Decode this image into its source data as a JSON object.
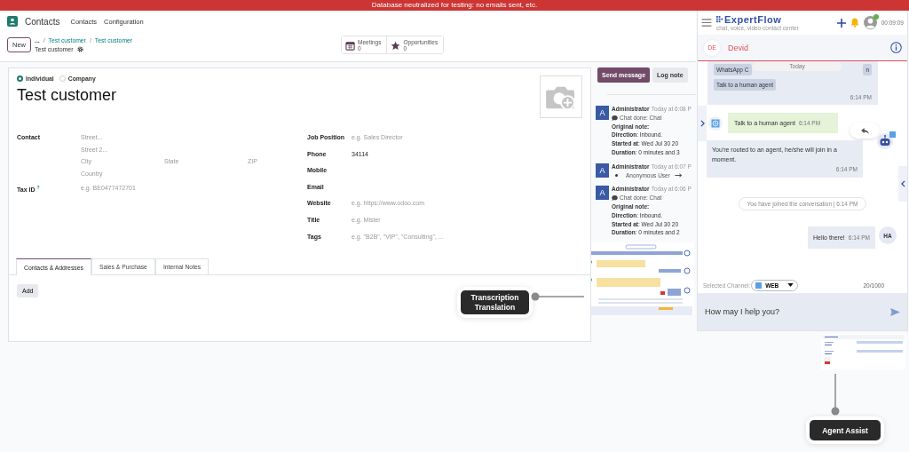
{
  "banner": "Database neutralized for testing: no emails sent, etc.",
  "app_bar": {
    "app": "Contacts",
    "menu": [
      "Contacts",
      "Configuration"
    ]
  },
  "control_panel": {
    "new_button": "New",
    "breadcrumb": [
      "...",
      "Test customer",
      "Test customer"
    ],
    "separator": "/",
    "record": "Test customer",
    "smart_buttons": [
      {
        "kind": "calendar",
        "label": "Meetings",
        "count": "0"
      },
      {
        "kind": "star",
        "label": "Opportunities",
        "count": "0"
      }
    ]
  },
  "form": {
    "company_type": [
      {
        "label": "Individual",
        "selected": true
      },
      {
        "label": "Company",
        "selected": false
      }
    ],
    "name": "Test customer",
    "address_label": "Contact",
    "address": {
      "street": "Street...",
      "street2": "Street 2...",
      "city": "City",
      "state": "State",
      "zip": "ZIP",
      "country": "Country"
    },
    "tax_label": "Tax ID",
    "tax_help": "?",
    "tax_placeholder": "e.g. BE0477472701",
    "fields": [
      {
        "label": "Job Position",
        "placeholder": "e.g. Sales Director"
      },
      {
        "label": "Phone",
        "value": "34114"
      },
      {
        "label": "Mobile"
      },
      {
        "label": "Email"
      },
      {
        "label": "Website",
        "placeholder": "e.g. https://www.odoo.com"
      },
      {
        "label": "Title",
        "placeholder": "e.g. Mister"
      },
      {
        "label": "Tags",
        "placeholder": "e.g. \"B2B\", \"VIP\", \"Consulting\", ..."
      }
    ],
    "tabs": [
      {
        "label": "Contacts & Addresses",
        "selected": true
      },
      {
        "label": "Sales & Purchase",
        "selected": false
      },
      {
        "label": "Internal Notes",
        "selected": false
      }
    ],
    "add_button": "Add"
  },
  "chatter": {
    "buttons": [
      {
        "label": "Send message",
        "primary": true
      },
      {
        "label": "Log note",
        "primary": false
      }
    ],
    "messages": [
      {
        "avatar": "A",
        "author": "Administrator",
        "time": "Today at 6:08 P",
        "lines": [
          {
            "kind": "note",
            "text": "Chat done: Chat"
          },
          {
            "kind": "plain",
            "text": "**Original note:**"
          },
          {
            "kind": "plain",
            "text": "**Direction**: Inbound."
          },
          {
            "kind": "plain",
            "text": "**Started at**: Wed Jul 30 20"
          },
          {
            "kind": "plain",
            "text": "**Duration**: 0 minutes and 3"
          }
        ]
      },
      {
        "avatar": "A",
        "author": "Administrator",
        "time": "Today at 6:07 P",
        "lines": [
          {
            "kind": "follower",
            "text": "Anonymous User"
          }
        ]
      },
      {
        "avatar": "A",
        "author": "Administrator",
        "time": "Today at 6:06 P",
        "lines": [
          {
            "kind": "note",
            "text": "Chat done: Chat"
          },
          {
            "kind": "plain",
            "text": "**Original note:**"
          },
          {
            "kind": "plain",
            "text": "**Direction**: Inbound."
          },
          {
            "kind": "plain",
            "text": "**Started at**: Wed Jul 30 20"
          },
          {
            "kind": "plain",
            "text": "**Duration**: 0 minutes and 2"
          }
        ]
      }
    ]
  },
  "transcription_callout": [
    "Transcription",
    "Translation"
  ],
  "chat": {
    "brand": "ExpertFlow",
    "tagline": "chat, voice, video contact center",
    "agent_online": true,
    "timer": "00:09:09",
    "customer": {
      "initials": "DE",
      "name": "Devid"
    },
    "date_pill": "Today",
    "messages": [
      {
        "kind": "options",
        "options": [
          "WhatsApp C",
          "n"
        ],
        "text": "Talk to a human agent",
        "time": "6:14 PM"
      },
      {
        "kind": "customer",
        "text": "Talk to a human agent",
        "time": "6:14 PM"
      },
      {
        "kind": "bot",
        "text": "You're routed to an agent, he/she will join in a moment.",
        "time": "6:14 PM"
      },
      {
        "kind": "system",
        "text": "You have joined the conversation | 6:14 PM"
      },
      {
        "kind": "agent",
        "text": "Hello there!",
        "time": "6:14 PM",
        "initials": "HA"
      }
    ],
    "channel_label": "Selected Channel:",
    "channel": "WEB",
    "counter": "20/1000",
    "input_placeholder": "How may I help you?"
  },
  "agent_assist_callout": "Agent Assist"
}
